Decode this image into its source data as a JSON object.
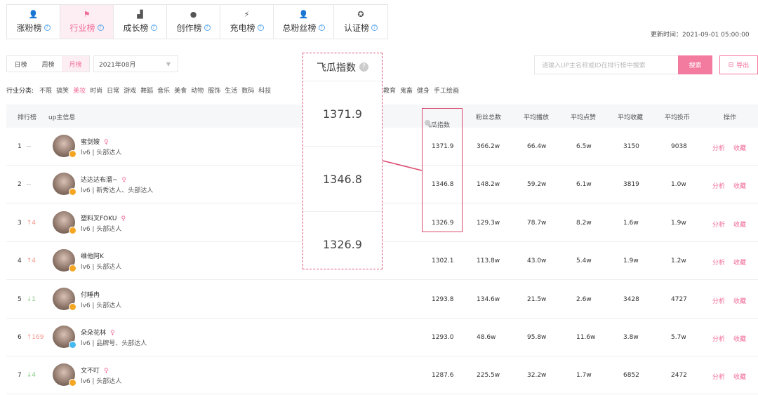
{
  "tabs": [
    {
      "icon": "fire-icon",
      "glyph": "👤",
      "label": "涨粉榜",
      "active": false
    },
    {
      "icon": "flag-icon",
      "glyph": "⚑",
      "label": "行业榜",
      "active": true
    },
    {
      "icon": "growth-icon",
      "glyph": "▟",
      "label": "成长榜",
      "active": false
    },
    {
      "icon": "bulb-icon",
      "glyph": "●",
      "label": "创作榜",
      "active": false
    },
    {
      "icon": "bolt-icon",
      "glyph": "⚡",
      "label": "充电榜",
      "active": false
    },
    {
      "icon": "users-icon",
      "glyph": "👤",
      "label": "总粉丝榜",
      "active": false
    },
    {
      "icon": "verified-icon",
      "glyph": "✪",
      "label": "认证榜",
      "active": false
    }
  ],
  "update_time": "更新时间：2021-09-01 05:00:00",
  "period": {
    "day": "日榜",
    "week": "周榜",
    "month": "月榜"
  },
  "month_value": "2021年08月",
  "search": {
    "placeholder": "请输入UP主名称或ID在排行榜中搜索",
    "button": "搜索"
  },
  "export_label": "导出",
  "categories": {
    "lead": "行业分类:",
    "items": [
      "不限",
      "搞笑",
      "美妆",
      "时尚",
      "日常",
      "游戏",
      "舞蹈",
      "音乐",
      "美食",
      "动物",
      "服饰",
      "生活",
      "数码",
      "科技"
    ],
    "more": [
      "教育",
      "鬼畜",
      "健身",
      "手工绘画"
    ]
  },
  "headers": {
    "rank": "排行榜",
    "up": "up主信息",
    "index": "飞瓜指数",
    "fans": "粉丝总数",
    "play": "平均播放",
    "like": "平均点赞",
    "fav": "平均收藏",
    "coin": "平均投币",
    "op": "操作"
  },
  "rows": [
    {
      "rank": "1",
      "trend": "--",
      "trend_type": "flat",
      "name": "蜜剑嫂",
      "female": true,
      "tags": "lv6 | 头部达人",
      "index": "1371.9",
      "fans": "366.2w",
      "play": "66.4w",
      "like": "6.5w",
      "fav": "3150",
      "coin": "9038",
      "badge": "gold"
    },
    {
      "rank": "2",
      "trend": "--",
      "trend_type": "flat",
      "name": "达达达布溜~",
      "female": true,
      "tags": "lv6 | 新秀达人、头部达人",
      "index": "1346.8",
      "fans": "148.2w",
      "play": "59.2w",
      "like": "6.1w",
      "fav": "3819",
      "coin": "1.0w",
      "badge": "gold"
    },
    {
      "rank": "3",
      "trend": "↑4",
      "trend_type": "up",
      "name": "塑料叉FOKU",
      "female": true,
      "tags": "lv6 | 头部达人",
      "index": "1326.9",
      "fans": "129.3w",
      "play": "78.7w",
      "like": "8.2w",
      "fav": "1.6w",
      "coin": "1.9w",
      "badge": "gold"
    },
    {
      "rank": "4",
      "trend": "↑4",
      "trend_type": "up",
      "name": "维他阿K",
      "female": false,
      "tags": "lv6 | 头部达人",
      "index": "1302.1",
      "fans": "113.8w",
      "play": "43.0w",
      "like": "5.4w",
      "fav": "1.9w",
      "coin": "1.2w",
      "badge": "gold"
    },
    {
      "rank": "5",
      "trend": "↓1",
      "trend_type": "down",
      "name": "付睡冉",
      "female": false,
      "tags": "lv6 | 头部达人",
      "index": "1293.8",
      "fans": "134.6w",
      "play": "21.5w",
      "like": "2.6w",
      "fav": "3428",
      "coin": "4727",
      "badge": "gold"
    },
    {
      "rank": "6",
      "trend": "↑169",
      "trend_type": "up",
      "name": "朵朵花林",
      "female": true,
      "tags": "lv6 | 品牌号、头部达人",
      "index": "1293.0",
      "fans": "48.6w",
      "play": "95.8w",
      "like": "11.6w",
      "fav": "3.8w",
      "coin": "5.7w",
      "badge": "blue"
    },
    {
      "rank": "7",
      "trend": "↓4",
      "trend_type": "down",
      "name": "文不叮",
      "female": true,
      "tags": "lv6 | 头部达人",
      "index": "1287.6",
      "fans": "225.5w",
      "play": "32.2w",
      "like": "1.7w",
      "fav": "6852",
      "coin": "2472",
      "badge": "gold"
    }
  ],
  "actions": {
    "analyze": "分析",
    "collect": "收藏"
  },
  "female_glyph": "♀",
  "callout": {
    "title": "飞瓜指数",
    "help_glyph": "?",
    "values": [
      "1371.9",
      "1346.8",
      "1326.9"
    ]
  },
  "colors": {
    "accent": "#f06b97",
    "highlight": "#d9486e"
  }
}
